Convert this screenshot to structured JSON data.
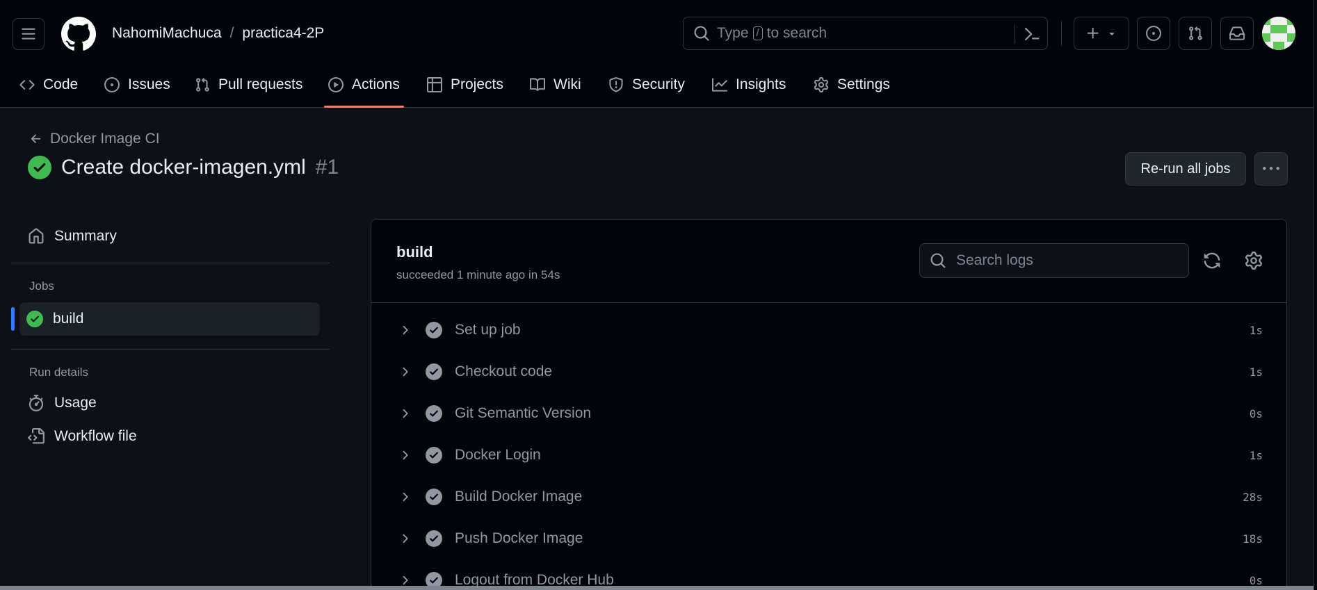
{
  "header": {
    "owner": "NahomiMachuca",
    "separator": "/",
    "repo": "practica4-2P",
    "search_prefix": "Type",
    "search_key": "/",
    "search_suffix": "to search"
  },
  "nav": {
    "tabs": [
      {
        "label": "Code",
        "icon": "code-icon"
      },
      {
        "label": "Issues",
        "icon": "issue-opened-icon"
      },
      {
        "label": "Pull requests",
        "icon": "git-pull-request-icon"
      },
      {
        "label": "Actions",
        "icon": "play-icon",
        "selected": true
      },
      {
        "label": "Projects",
        "icon": "table-icon"
      },
      {
        "label": "Wiki",
        "icon": "book-icon"
      },
      {
        "label": "Security",
        "icon": "shield-icon"
      },
      {
        "label": "Insights",
        "icon": "graph-icon"
      },
      {
        "label": "Settings",
        "icon": "gear-icon"
      }
    ]
  },
  "run": {
    "back_label": "Docker Image CI",
    "title": "Create docker-imagen.yml",
    "number": "#1",
    "rerun_label": "Re-run all jobs"
  },
  "sidebar": {
    "summary": "Summary",
    "jobs_heading": "Jobs",
    "job": "build",
    "run_details_heading": "Run details",
    "usage": "Usage",
    "workflow_file": "Workflow file"
  },
  "job": {
    "name": "build",
    "status": "succeeded 1 minute ago in 54s",
    "search_placeholder": "Search logs",
    "steps": [
      {
        "name": "Set up job",
        "duration": "1s"
      },
      {
        "name": "Checkout code",
        "duration": "1s"
      },
      {
        "name": "Git Semantic Version",
        "duration": "0s"
      },
      {
        "name": "Docker Login",
        "duration": "1s"
      },
      {
        "name": "Build Docker Image",
        "duration": "28s"
      },
      {
        "name": "Push Docker Image",
        "duration": "18s"
      },
      {
        "name": "Logout from Docker Hub",
        "duration": "0s"
      }
    ]
  },
  "colors": {
    "success": "#3fb950",
    "accent_underline": "#f78166",
    "selected_bar": "#2f81f7"
  }
}
